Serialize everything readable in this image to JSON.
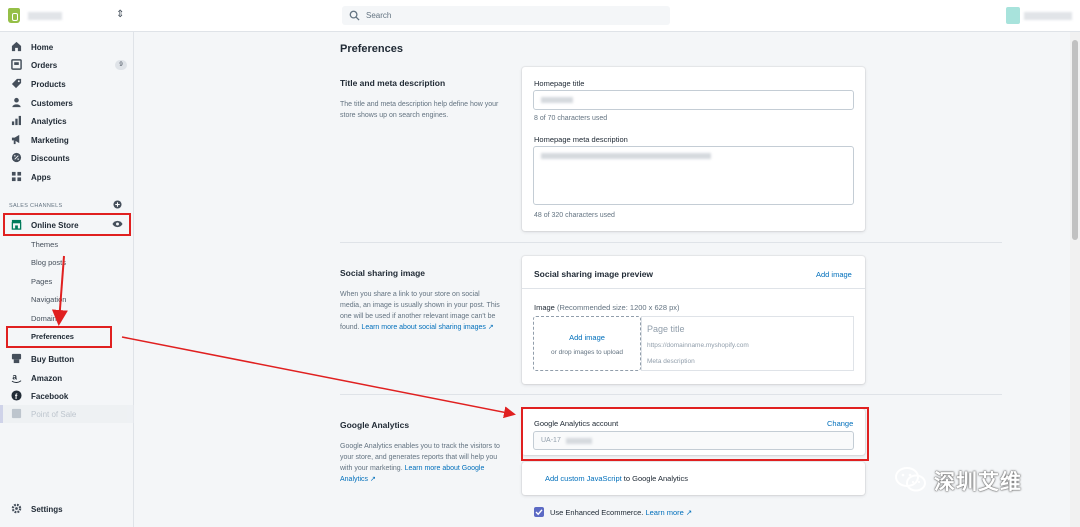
{
  "topbar": {
    "search_placeholder": "Search",
    "switch_glyph": "⇕"
  },
  "sidebar": {
    "home": "Home",
    "orders": "Orders",
    "orders_badge": "9",
    "products": "Products",
    "customers": "Customers",
    "analytics": "Analytics",
    "marketing": "Marketing",
    "discounts": "Discounts",
    "apps": "Apps",
    "sales_channels": "SALES CHANNELS",
    "online_store": "Online Store",
    "themes": "Themes",
    "blog_posts": "Blog posts",
    "pages": "Pages",
    "navigation": "Navigation",
    "domains": "Domains",
    "preferences": "Preferences",
    "buy_button": "Buy Button",
    "amazon": "Amazon",
    "facebook": "Facebook",
    "point_of_sale": "Point of Sale",
    "settings": "Settings"
  },
  "main": {
    "page_title": "Preferences",
    "title_meta": {
      "title": "Title and meta description",
      "description": "The title and meta description help define how your store shows up on search engines.",
      "homepage_title_label": "Homepage title",
      "title_count": "8 of 70 characters used",
      "meta_label": "Homepage meta description",
      "meta_count": "48 of 320 characters used"
    },
    "social": {
      "title": "Social sharing image",
      "description": "When you share a link to your store on social media, an image is usually shown in your post. This one will be used if another relevant image can't be found. ",
      "learn_more": "Learn more about social sharing images",
      "card_title": "Social sharing image preview",
      "add_image": "Add image",
      "image_label": "Image",
      "image_recommend": "(Recommended size: 1200 x 628 px)",
      "upload_add": "Add image",
      "upload_drop": "or drop images to upload",
      "preview_title": "Page title",
      "preview_url": "https://domainname.myshopify.com",
      "preview_desc": "Meta description"
    },
    "analytics": {
      "title": "Google Analytics",
      "description": "Google Analytics enables you to track the visitors to your store, and generates reports that will help you with your marketing. ",
      "learn_more": "Learn more about Google Analytics",
      "account_label": "Google Analytics account",
      "change": "Change",
      "account_value": "UA-17",
      "custom_js_link": "Add custom JavaScript",
      "custom_js_rest": " to Google Analytics",
      "enhanced": "Use Enhanced Ecommerce. ",
      "enhanced_link": "Learn more"
    }
  },
  "watermark": {
    "text": "深圳艾维"
  },
  "colors": {
    "accent": "#5c6ac4",
    "link": "#006fbb",
    "annotation": "#e02020",
    "brand": "#95bf47"
  }
}
